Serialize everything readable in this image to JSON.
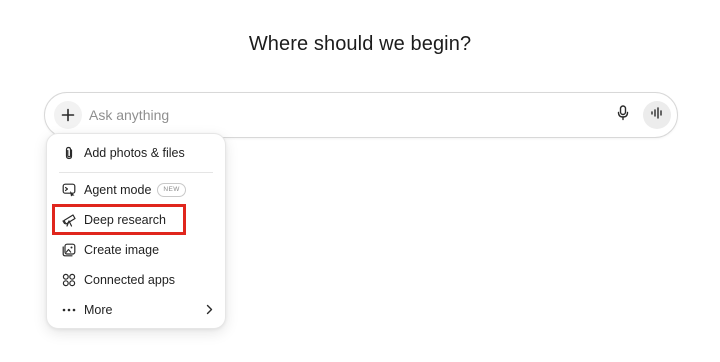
{
  "heading": "Where should we begin?",
  "composer": {
    "placeholder": "Ask anything",
    "plus_icon": "plus-icon",
    "mic_icon": "microphone-icon",
    "voice_icon": "voice-mode-icon"
  },
  "menu": {
    "items": [
      {
        "label": "Add photos & files",
        "icon": "paperclip-icon"
      },
      {
        "label": "Agent mode",
        "icon": "agent-mode-icon",
        "badge": "NEW"
      },
      {
        "label": "Deep research",
        "icon": "telescope-icon",
        "highlighted": true
      },
      {
        "label": "Create image",
        "icon": "image-icon"
      },
      {
        "label": "Connected apps",
        "icon": "connected-apps-icon"
      },
      {
        "label": "More",
        "icon": "ellipsis-icon",
        "submenu_icon": "chevron-right-icon"
      }
    ]
  },
  "colors": {
    "highlight": "#e0261d",
    "placeholder": "#8f8f8f",
    "text": "#1f1f1f"
  }
}
